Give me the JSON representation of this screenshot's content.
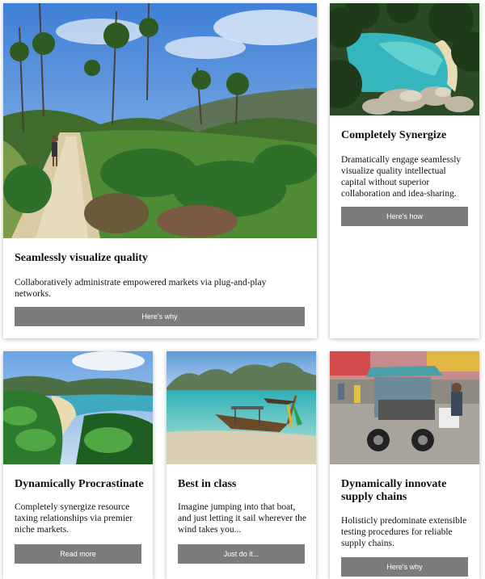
{
  "cards": [
    {
      "title": "Seamlessly visualize quality",
      "text": "Collaboratively administrate empowered markets via plug-and-play networks.",
      "button": "Here's why"
    },
    {
      "title": "Completely Synergize",
      "text": "Dramatically engage seamlessly visualize quality intellectual capital without superior collaboration and idea-sharing.",
      "button": "Here's how"
    },
    {
      "title": "Dynamically Procrastinate",
      "text": "Completely synergize resource taxing relationships via premier niche markets.",
      "button": "Read more"
    },
    {
      "title": "Best in class",
      "text": "Imagine jumping into that boat, and just letting it sail wherever the wind takes you...",
      "button": "Just do it..."
    },
    {
      "title": "Dynamically innovate supply chains",
      "text": "Holisticly predominate extensible testing procedures for reliable supply chains.",
      "button": "Here's why"
    }
  ]
}
